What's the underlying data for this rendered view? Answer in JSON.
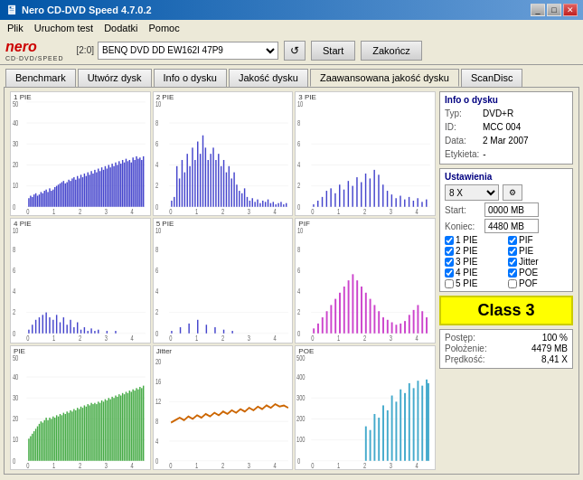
{
  "titlebar": {
    "title": "Nero CD-DVD Speed 4.7.0.2",
    "icon": "●",
    "controls": [
      "_",
      "□",
      "✕"
    ]
  },
  "menubar": {
    "items": [
      "Plik",
      "Uruchom test",
      "Dodatki",
      "Pomoc"
    ]
  },
  "toolbar": {
    "logo": "nero",
    "logo_sub": "CD·DVD/SPEED",
    "drive_label": "[2:0]",
    "drive_value": "BENQ DVD DD EW162I 47P9",
    "btn_refresh": "↺",
    "btn_start": "Start",
    "btn_end": "Zakończ"
  },
  "tabs": [
    {
      "label": "Benchmark",
      "active": false
    },
    {
      "label": "Utwórz dysk",
      "active": false
    },
    {
      "label": "Info o dysku",
      "active": false
    },
    {
      "label": "Jakość dysku",
      "active": false
    },
    {
      "label": "Zaawansowana jakość dysku",
      "active": true
    },
    {
      "label": "ScanDisc",
      "active": false
    }
  ],
  "charts": [
    {
      "id": "pie1",
      "title": "1 PIE",
      "color": "#4444cc",
      "type": "bar",
      "ymax": 50,
      "yticks": [
        10,
        20,
        30,
        40,
        50
      ],
      "xticks": [
        0,
        1,
        2,
        3,
        4
      ]
    },
    {
      "id": "pie2",
      "title": "2 PIE",
      "color": "#4444cc",
      "type": "bar",
      "ymax": 10,
      "yticks": [
        2,
        4,
        6,
        8,
        10
      ],
      "xticks": [
        0,
        1,
        2,
        3,
        4
      ]
    },
    {
      "id": "pie3",
      "title": "3 PIE",
      "color": "#4444cc",
      "type": "bar",
      "ymax": 10,
      "yticks": [
        2,
        4,
        6,
        8,
        10
      ],
      "xticks": [
        0,
        1,
        2,
        3,
        4
      ]
    },
    {
      "id": "pie4",
      "title": "4 PIE",
      "color": "#4444cc",
      "type": "bar",
      "ymax": 10,
      "yticks": [
        2,
        4,
        6,
        8,
        10
      ],
      "xticks": [
        0,
        1,
        2,
        3,
        4
      ]
    },
    {
      "id": "pie5",
      "title": "5 PIE",
      "color": "#4444cc",
      "type": "bar",
      "ymax": 10,
      "yticks": [
        2,
        4,
        6,
        8,
        10
      ],
      "xticks": [
        0,
        1,
        2,
        3,
        4
      ]
    },
    {
      "id": "pif",
      "title": "PIF",
      "color": "#cc44cc",
      "type": "bar",
      "ymax": 10,
      "yticks": [
        2,
        4,
        6,
        8,
        10
      ],
      "xticks": [
        0,
        1,
        2,
        3,
        4
      ]
    },
    {
      "id": "pie_g",
      "title": "PIE",
      "color": "#44aa44",
      "type": "bar",
      "ymax": 50,
      "yticks": [
        10,
        20,
        30,
        40,
        50
      ],
      "xticks": [
        0,
        1,
        2,
        3,
        4
      ]
    },
    {
      "id": "jitter",
      "title": "Jitter",
      "color": "#cc6600",
      "type": "line",
      "ymax": 20,
      "yticks": [
        4,
        8,
        12,
        16,
        20
      ],
      "xticks": [
        0,
        1,
        2,
        3,
        4
      ]
    },
    {
      "id": "poe",
      "title": "POE",
      "color": "#44aacc",
      "type": "bar",
      "ymax": 500,
      "yticks": [
        100,
        200,
        300,
        400,
        500
      ],
      "xticks": [
        0,
        1,
        2,
        3,
        4
      ]
    }
  ],
  "info": {
    "section_title": "Info o dysku",
    "typ_label": "Typ:",
    "typ_value": "DVD+R",
    "id_label": "ID:",
    "id_value": "MCC 004",
    "data_label": "Data:",
    "data_value": "2 Mar 2007",
    "etykieta_label": "Etykieta:",
    "etykieta_value": "-"
  },
  "settings": {
    "section_title": "Ustawienia",
    "speed_label": "8 X",
    "start_label": "Start:",
    "start_value": "0000 MB",
    "end_label": "Koniec:",
    "end_value": "4480 MB"
  },
  "checkboxes": [
    {
      "id": "cb1pie",
      "label": "1 PIE",
      "checked": true
    },
    {
      "id": "cbpif",
      "label": "PIF",
      "checked": true
    },
    {
      "id": "cb2pie",
      "label": "2 PIE",
      "checked": true
    },
    {
      "id": "cbpie_r",
      "label": "PIE",
      "checked": true
    },
    {
      "id": "cb3pie",
      "label": "3 PIE",
      "checked": true
    },
    {
      "id": "cbjitter",
      "label": "Jitter",
      "checked": true
    },
    {
      "id": "cb4pie",
      "label": "4 PIE",
      "checked": true
    },
    {
      "id": "cbpoe",
      "label": "POE",
      "checked": true
    },
    {
      "id": "cb5pie",
      "label": "5 PIE",
      "checked": false
    },
    {
      "id": "cbpof",
      "label": "POF",
      "checked": false
    }
  ],
  "class_badge": {
    "text": "Class 3"
  },
  "progress": {
    "postep_label": "Postęp:",
    "postep_value": "100 %",
    "polozenie_label": "Położenie:",
    "polozenie_value": "4479 MB",
    "predkosc_label": "Prędkość:",
    "predkosc_value": "8,41 X"
  }
}
